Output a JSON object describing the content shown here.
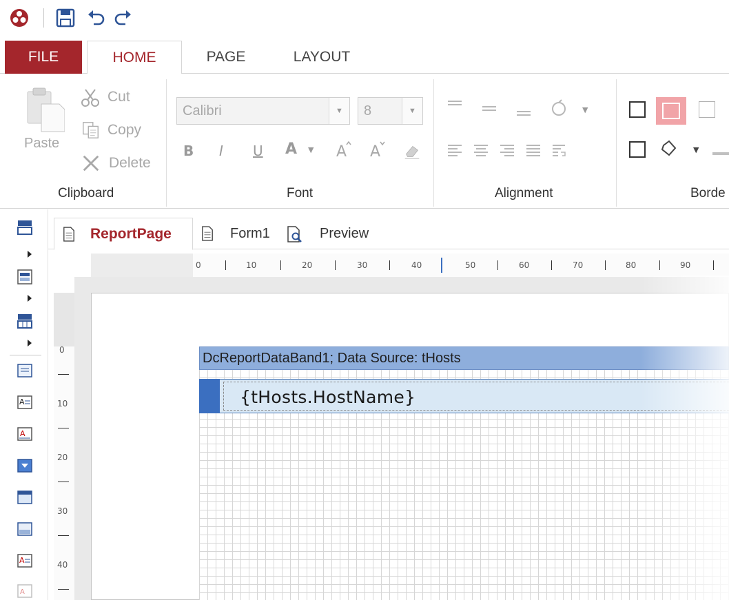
{
  "quick_access": {
    "icons": [
      "app-logo-icon",
      "save-icon",
      "undo-icon",
      "redo-icon"
    ]
  },
  "ribbon_tabs": [
    {
      "label": "FILE"
    },
    {
      "label": "HOME"
    },
    {
      "label": "PAGE"
    },
    {
      "label": "LAYOUT"
    }
  ],
  "clipboard": {
    "paste": "Paste",
    "cut": "Cut",
    "copy": "Copy",
    "delete": "Delete",
    "group_label": "Clipboard"
  },
  "font": {
    "family": "Calibri",
    "size": "8",
    "bold": "B",
    "italic": "I",
    "underline": "U",
    "color": "A",
    "group_label": "Font"
  },
  "alignment": {
    "group_label": "Alignment"
  },
  "borders": {
    "group_label": "Borde"
  },
  "doc_tabs": [
    {
      "label": "ReportPage"
    },
    {
      "label": "Form1"
    },
    {
      "label": "Preview"
    }
  ],
  "h_ruler": [
    "0",
    "10",
    "20",
    "30",
    "40",
    "50",
    "60",
    "70",
    "80",
    "90"
  ],
  "v_ruler": [
    "0",
    "10",
    "20",
    "30",
    "40"
  ],
  "band": {
    "header": "DcReportDataBand1; Data Source: tHosts",
    "field": "{tHosts.HostName}"
  },
  "colors": {
    "accent": "#a4262c",
    "band_header": "#8eaedc",
    "band_row": "#d9e8f5",
    "band_handle": "#3b6fc0"
  }
}
